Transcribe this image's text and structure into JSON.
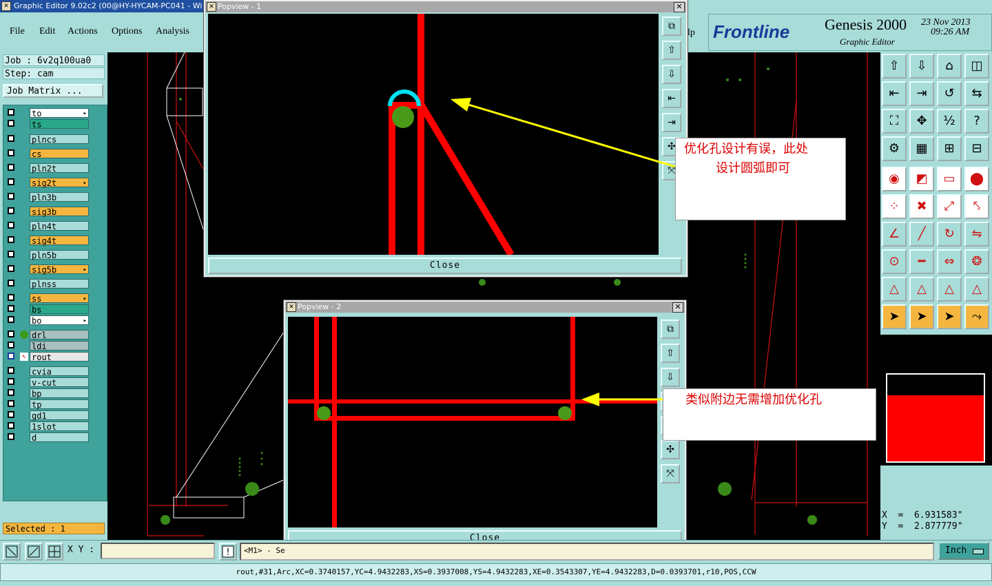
{
  "window": {
    "title": "Graphic Editor 9.02c2 (00@HY-HYCAM-PC041 - Wi"
  },
  "menu": {
    "file": "File",
    "edit": "Edit",
    "actions": "Actions",
    "options": "Options",
    "analysis": "Analysis",
    "help_partial": "lp"
  },
  "brand": {
    "logo": "Frontline",
    "product": "Genesis 2000",
    "subtitle": "Graphic Editor",
    "date": "23 Nov 2013",
    "time": "09:26 AM"
  },
  "job": {
    "job_label": "Job  :  6v2q100ua0",
    "step_label": "Step:  cam",
    "matrix_button": "Job Matrix ..."
  },
  "layers": [
    {
      "name": "to",
      "color": "#ffffff",
      "mark": true
    },
    {
      "name": "ts",
      "color": "#2aa88a",
      "mark": false
    },
    {
      "name": "plncs",
      "color": "#a8dcd8",
      "mark": false
    },
    {
      "name": "cs",
      "color": "#f5b640",
      "mark": false
    },
    {
      "name": "pln2t",
      "color": "#a8dcd8",
      "mark": false
    },
    {
      "name": "sig2t",
      "color": "#f5b640",
      "mark": true
    },
    {
      "name": "pln3b",
      "color": "#a8dcd8",
      "mark": false
    },
    {
      "name": "sig3b",
      "color": "#f5b640",
      "mark": false
    },
    {
      "name": "pln4t",
      "color": "#a8dcd8",
      "mark": false
    },
    {
      "name": "sig4t",
      "color": "#f5b640",
      "mark": false
    },
    {
      "name": "pln5b",
      "color": "#a8dcd8",
      "mark": false
    },
    {
      "name": "sig5b",
      "color": "#f5b640",
      "mark": true
    },
    {
      "name": "plnss",
      "color": "#a8dcd8",
      "mark": false
    },
    {
      "name": "ss",
      "color": "#f5b640",
      "mark": true
    },
    {
      "name": "bs",
      "color": "#2aa88a",
      "mark": false
    },
    {
      "name": "bo",
      "color": "#ffffff",
      "mark": true
    },
    {
      "name": "drl",
      "color": "#a8c0c0",
      "mark": false
    },
    {
      "name": "ldi",
      "color": "#a8c0c0",
      "mark": false
    },
    {
      "name": "rout",
      "color": "#e6e6e6",
      "mark": false
    },
    {
      "name": "cvia",
      "color": "#a8dcd8",
      "mark": false
    },
    {
      "name": "v-cut",
      "color": "#a8dcd8",
      "mark": false
    },
    {
      "name": "bp",
      "color": "#a8dcd8",
      "mark": false
    },
    {
      "name": "tp",
      "color": "#a8dcd8",
      "mark": false
    },
    {
      "name": "gd1",
      "color": "#a8dcd8",
      "mark": false
    },
    {
      "name": "1slot",
      "color": "#a8dcd8",
      "mark": false
    },
    {
      "name": "d",
      "color": "#a8dcd8",
      "mark": false
    }
  ],
  "selected_label": "Selected : 1",
  "coords": {
    "x": "X  =  6.931583\"",
    "y": "Y  =  2.877779\""
  },
  "popup1": {
    "title": "Popview - 1",
    "close": "Close",
    "note_line1": "优化孔设计有误，此处",
    "note_line2": "设计圆弧即可"
  },
  "popup2": {
    "title": "Popview - 2",
    "close": "Close",
    "note": "类似附边无需增加优化孔"
  },
  "bottom": {
    "xy_label": "X Y :",
    "xy_value": "",
    "message": "<M1> - Se",
    "unit": "Inch",
    "status": "rout,#31,Arc,XC=0.3740157,YC=4.9432283,XS=0.3937008,YS=4.9432283,XE=0.3543307,YE=4.9432283,D=0.0393701,r10,POS,CCW"
  },
  "toolbar_icons": [
    "zoom-home-icon",
    "zoom-in-icon",
    "home-icon",
    "split-icon",
    "pan-left-icon",
    "pan-right-icon",
    "rotate-icon",
    "mirror-icon",
    "fit-icon",
    "center-icon",
    "scale-1-2-icon",
    "help-icon",
    "settings-icon",
    "grid-icon",
    "layers-a-icon",
    "layers-b-icon",
    "pad-icon",
    "line-color-icon",
    "ruler-icon",
    "dot-icon",
    "node-icon",
    "cross-icon",
    "arrow-pad-icon",
    "pad-add-icon",
    "angle-icon",
    "slash-icon",
    "arc-icon",
    "flip-icon",
    "move-pad-icon",
    "line-icon",
    "measure-icon",
    "circles-icon",
    "triangle-a-icon",
    "triangle-b-icon",
    "triangle-c-icon",
    "triangle-d-icon",
    "select-arrow-icon",
    "select-box-icon",
    "select-multi-icon",
    "select-path-icon"
  ]
}
